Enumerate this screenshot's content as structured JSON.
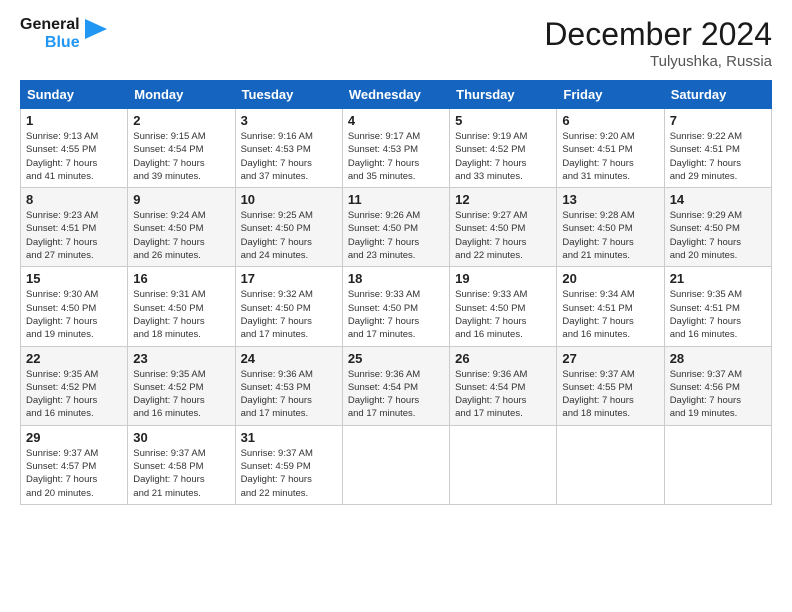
{
  "logo": {
    "line1": "General",
    "line2": "Blue"
  },
  "title": "December 2024",
  "subtitle": "Tulyushka, Russia",
  "weekdays": [
    "Sunday",
    "Monday",
    "Tuesday",
    "Wednesday",
    "Thursday",
    "Friday",
    "Saturday"
  ],
  "weeks": [
    [
      {
        "day": "1",
        "info": "Sunrise: 9:13 AM\nSunset: 4:55 PM\nDaylight: 7 hours\nand 41 minutes."
      },
      {
        "day": "2",
        "info": "Sunrise: 9:15 AM\nSunset: 4:54 PM\nDaylight: 7 hours\nand 39 minutes."
      },
      {
        "day": "3",
        "info": "Sunrise: 9:16 AM\nSunset: 4:53 PM\nDaylight: 7 hours\nand 37 minutes."
      },
      {
        "day": "4",
        "info": "Sunrise: 9:17 AM\nSunset: 4:53 PM\nDaylight: 7 hours\nand 35 minutes."
      },
      {
        "day": "5",
        "info": "Sunrise: 9:19 AM\nSunset: 4:52 PM\nDaylight: 7 hours\nand 33 minutes."
      },
      {
        "day": "6",
        "info": "Sunrise: 9:20 AM\nSunset: 4:51 PM\nDaylight: 7 hours\nand 31 minutes."
      },
      {
        "day": "7",
        "info": "Sunrise: 9:22 AM\nSunset: 4:51 PM\nDaylight: 7 hours\nand 29 minutes."
      }
    ],
    [
      {
        "day": "8",
        "info": "Sunrise: 9:23 AM\nSunset: 4:51 PM\nDaylight: 7 hours\nand 27 minutes."
      },
      {
        "day": "9",
        "info": "Sunrise: 9:24 AM\nSunset: 4:50 PM\nDaylight: 7 hours\nand 26 minutes."
      },
      {
        "day": "10",
        "info": "Sunrise: 9:25 AM\nSunset: 4:50 PM\nDaylight: 7 hours\nand 24 minutes."
      },
      {
        "day": "11",
        "info": "Sunrise: 9:26 AM\nSunset: 4:50 PM\nDaylight: 7 hours\nand 23 minutes."
      },
      {
        "day": "12",
        "info": "Sunrise: 9:27 AM\nSunset: 4:50 PM\nDaylight: 7 hours\nand 22 minutes."
      },
      {
        "day": "13",
        "info": "Sunrise: 9:28 AM\nSunset: 4:50 PM\nDaylight: 7 hours\nand 21 minutes."
      },
      {
        "day": "14",
        "info": "Sunrise: 9:29 AM\nSunset: 4:50 PM\nDaylight: 7 hours\nand 20 minutes."
      }
    ],
    [
      {
        "day": "15",
        "info": "Sunrise: 9:30 AM\nSunset: 4:50 PM\nDaylight: 7 hours\nand 19 minutes."
      },
      {
        "day": "16",
        "info": "Sunrise: 9:31 AM\nSunset: 4:50 PM\nDaylight: 7 hours\nand 18 minutes."
      },
      {
        "day": "17",
        "info": "Sunrise: 9:32 AM\nSunset: 4:50 PM\nDaylight: 7 hours\nand 17 minutes."
      },
      {
        "day": "18",
        "info": "Sunrise: 9:33 AM\nSunset: 4:50 PM\nDaylight: 7 hours\nand 17 minutes."
      },
      {
        "day": "19",
        "info": "Sunrise: 9:33 AM\nSunset: 4:50 PM\nDaylight: 7 hours\nand 16 minutes."
      },
      {
        "day": "20",
        "info": "Sunrise: 9:34 AM\nSunset: 4:51 PM\nDaylight: 7 hours\nand 16 minutes."
      },
      {
        "day": "21",
        "info": "Sunrise: 9:35 AM\nSunset: 4:51 PM\nDaylight: 7 hours\nand 16 minutes."
      }
    ],
    [
      {
        "day": "22",
        "info": "Sunrise: 9:35 AM\nSunset: 4:52 PM\nDaylight: 7 hours\nand 16 minutes."
      },
      {
        "day": "23",
        "info": "Sunrise: 9:35 AM\nSunset: 4:52 PM\nDaylight: 7 hours\nand 16 minutes."
      },
      {
        "day": "24",
        "info": "Sunrise: 9:36 AM\nSunset: 4:53 PM\nDaylight: 7 hours\nand 17 minutes."
      },
      {
        "day": "25",
        "info": "Sunrise: 9:36 AM\nSunset: 4:54 PM\nDaylight: 7 hours\nand 17 minutes."
      },
      {
        "day": "26",
        "info": "Sunrise: 9:36 AM\nSunset: 4:54 PM\nDaylight: 7 hours\nand 17 minutes."
      },
      {
        "day": "27",
        "info": "Sunrise: 9:37 AM\nSunset: 4:55 PM\nDaylight: 7 hours\nand 18 minutes."
      },
      {
        "day": "28",
        "info": "Sunrise: 9:37 AM\nSunset: 4:56 PM\nDaylight: 7 hours\nand 19 minutes."
      }
    ],
    [
      {
        "day": "29",
        "info": "Sunrise: 9:37 AM\nSunset: 4:57 PM\nDaylight: 7 hours\nand 20 minutes."
      },
      {
        "day": "30",
        "info": "Sunrise: 9:37 AM\nSunset: 4:58 PM\nDaylight: 7 hours\nand 21 minutes."
      },
      {
        "day": "31",
        "info": "Sunrise: 9:37 AM\nSunset: 4:59 PM\nDaylight: 7 hours\nand 22 minutes."
      },
      null,
      null,
      null,
      null
    ]
  ]
}
